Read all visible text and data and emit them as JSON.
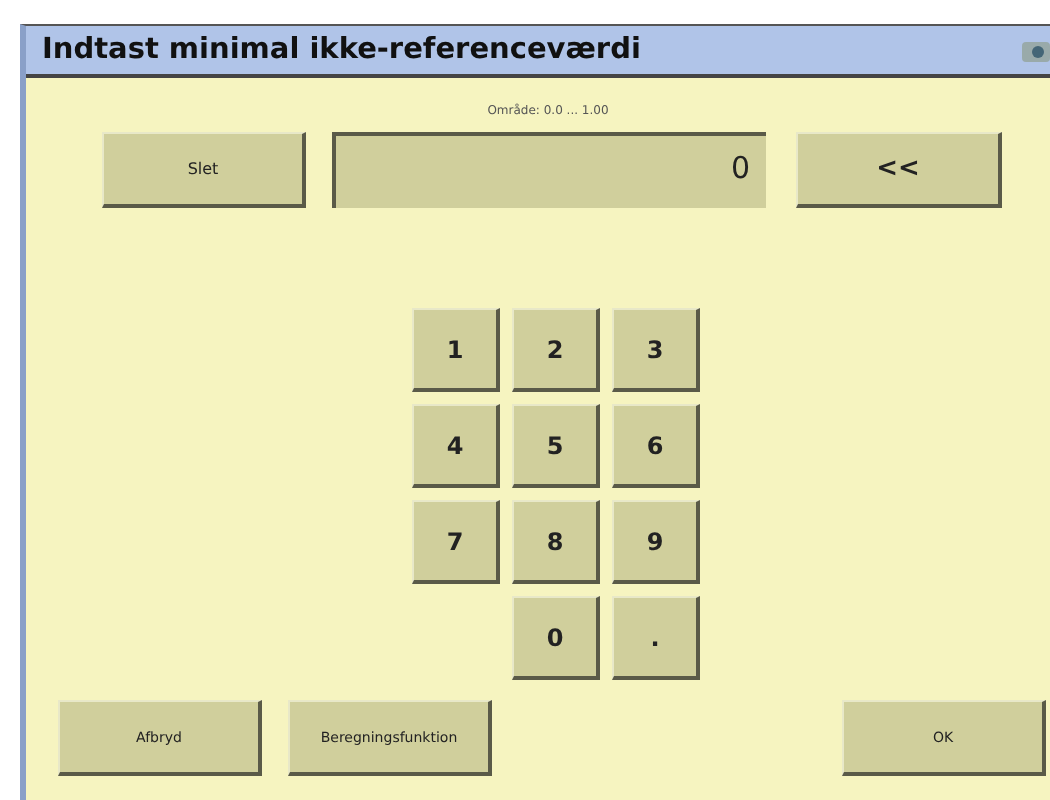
{
  "window": {
    "title": "Indtast minimal ikke-referenceværdi"
  },
  "range_label": "Område: 0.0 ... 1.00",
  "delete_button": "Slet",
  "display": {
    "value": "0"
  },
  "backspace_button": "<<",
  "keypad": [
    "1",
    "2",
    "3",
    "4",
    "5",
    "6",
    "7",
    "8",
    "9",
    "0",
    "."
  ],
  "bottom_buttons": [
    {
      "label": "Afbryd",
      "kind": "cancel"
    },
    {
      "label": "Beregningsfunktion",
      "kind": "function"
    },
    {
      "label": "OK",
      "kind": "ok"
    }
  ]
}
